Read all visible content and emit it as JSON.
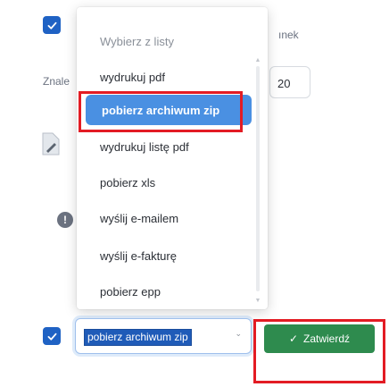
{
  "background": {
    "header_fragment": "ınek",
    "search_fragment": "Znale",
    "page_size_value": "20",
    "info_glyph": "!"
  },
  "dropdown": {
    "header": "Wybierz z listy",
    "options": [
      "wydrukuj pdf",
      "pobierz archiwum zip",
      "wydrukuj listę pdf",
      "pobierz xls",
      "wyślij e-mailem",
      "wyślij e-fakturę",
      "pobierz epp"
    ],
    "selected_index": 1
  },
  "action_select": {
    "value": "pobierz archiwum zip",
    "chevron": "⌄"
  },
  "submit": {
    "label": "Zatwierdź",
    "check_glyph": "✓"
  },
  "colors": {
    "accent": "#1f62c4",
    "selected_option": "#4a90e2",
    "submit_button": "#2e8b4e",
    "highlight": "#e31c24"
  }
}
